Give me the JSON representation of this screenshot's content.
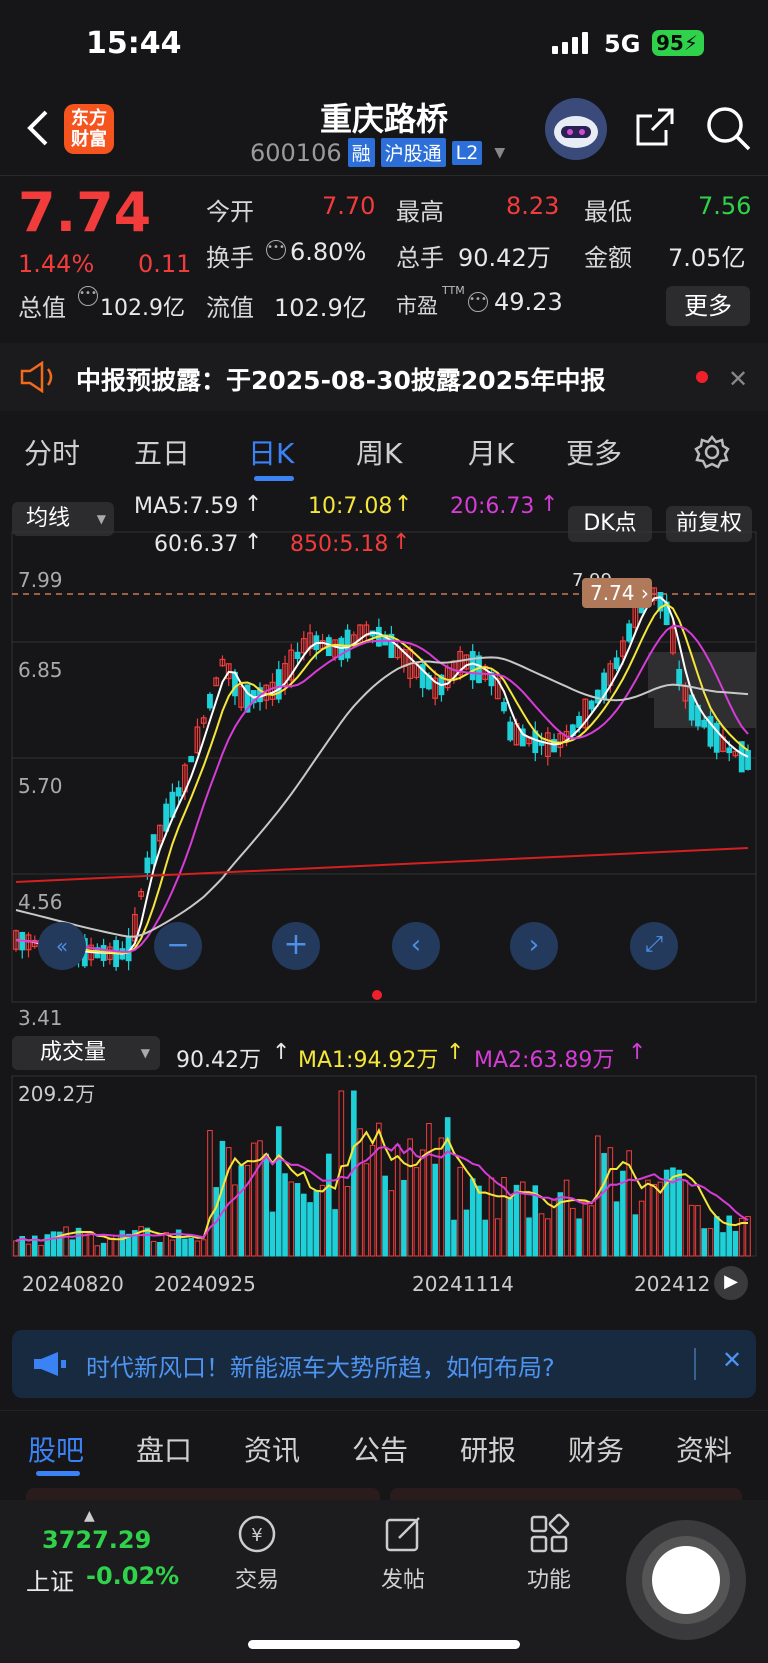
{
  "status": {
    "time": "15:44",
    "network": "5G",
    "battery": "95"
  },
  "header": {
    "logo_line1": "东方",
    "logo_line2": "财富",
    "stock_name": "重庆路桥",
    "code": "600106",
    "tags": [
      "融",
      "沪股通",
      "L2"
    ]
  },
  "quote": {
    "price": "7.74",
    "pct": "1.44%",
    "change": "0.11",
    "labels": {
      "open": "今开",
      "high": "最高",
      "low": "最低",
      "turnover": "换手",
      "volume": "总手",
      "amount": "金额",
      "mktcap": "总值",
      "float_cap": "流值",
      "pe": "市盈",
      "pe_sup": "TTM"
    },
    "values": {
      "open": "7.70",
      "high": "8.23",
      "low": "7.56",
      "turnover": "6.80%",
      "volume": "90.42万",
      "amount": "7.05亿",
      "mktcap": "102.9亿",
      "float_cap": "102.9亿",
      "pe": "49.23"
    },
    "more": "更多"
  },
  "notice": {
    "text": "中报预披露：于2025-08-30披露2025年中报"
  },
  "tabs": [
    "分时",
    "五日",
    "日K",
    "周K",
    "月K",
    "更多"
  ],
  "active_tab": "日K",
  "chart_controls": {
    "ma_select": "均线",
    "dk": "DK点",
    "adjust": "前复权",
    "vol_select": "成交量"
  },
  "ma_legend": {
    "ma5": "MA5:7.59",
    "ma10": "10:7.08",
    "ma20": "20:6.73",
    "ma60": "60:6.37",
    "ma850": "850:5.18"
  },
  "vol_legend": {
    "vol": "90.42万",
    "ma1": "MA1:94.92万",
    "ma2": "MA2:63.89万"
  },
  "chart_data": {
    "type": "candlestick",
    "y_ticks": [
      "7.99",
      "6.85",
      "5.70",
      "4.56",
      "3.41"
    ],
    "top_label": "7.99",
    "price_tag": "7.74",
    "vol_max_label": "209.2万",
    "x_labels": [
      "20240820",
      "20240925",
      "20241114",
      "202412"
    ],
    "colors": {
      "up": "#f23c3c",
      "down": "#1fd0d8",
      "ma5": "#ffffff",
      "ma10": "#f5e63a",
      "ma20": "#d63cd6",
      "ma60": "#c8c8c8",
      "ma850": "#d42020"
    }
  },
  "banner": {
    "text": "时代新风口！新能源车大势所趋，如何布局?"
  },
  "footer_tabs": [
    "股吧",
    "盘口",
    "资讯",
    "公告",
    "研报",
    "财务",
    "资料"
  ],
  "bottom_nav": {
    "index_value": "3727.29",
    "index_name": "上证",
    "index_change": "-0.02%",
    "trade": "交易",
    "post": "发帖",
    "func": "功能"
  }
}
